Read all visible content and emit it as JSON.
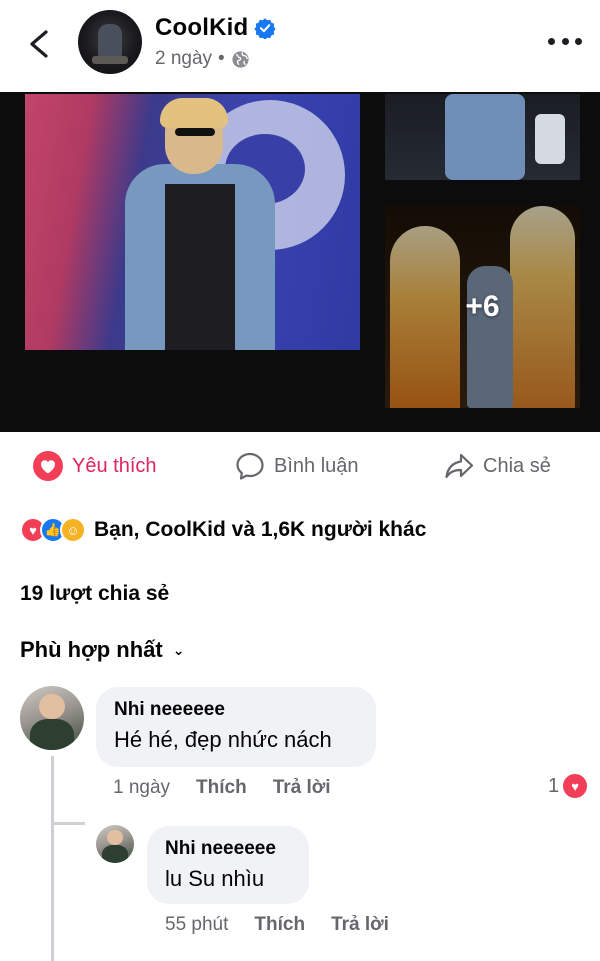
{
  "header": {
    "author": "CoolKid",
    "time": "2 ngày",
    "separator": "•"
  },
  "photos": {
    "more_count": "+6"
  },
  "actions": {
    "like": "Yêu thích",
    "comment": "Bình luận",
    "share": "Chia sẻ"
  },
  "reactions": {
    "summary": "Bạn, CoolKid và 1,6K người khác"
  },
  "shares": "19 lượt chia sẻ",
  "sort": "Phù hợp nhất",
  "comments": [
    {
      "name": "Nhi neeeeee",
      "text": "Hé hé, đẹp nhức nách",
      "time": "1 ngày",
      "like": "Thích",
      "reply": "Trả lời",
      "reaction_count": "1"
    },
    {
      "name": "Nhi neeeeee",
      "text": "lu Su nhìu",
      "time": "55 phút",
      "like": "Thích",
      "reply": "Trả lời"
    }
  ],
  "colors": {
    "like_pink": "#e0245e",
    "verified_blue": "#1877f2",
    "muted": "#65676b"
  }
}
